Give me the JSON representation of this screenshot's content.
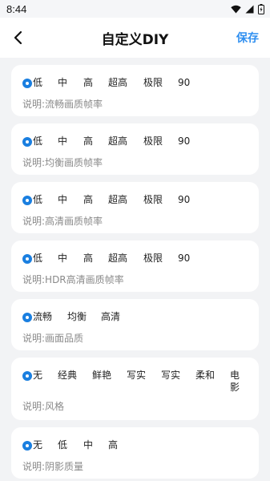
{
  "status": {
    "time": "8:44"
  },
  "nav": {
    "title": "自定义DIY",
    "save": "保存"
  },
  "cards": [
    {
      "options": [
        "低",
        "中",
        "高",
        "超高",
        "极限",
        "90"
      ],
      "desc": "说明:流畅画质帧率"
    },
    {
      "options": [
        "低",
        "中",
        "高",
        "超高",
        "极限",
        "90"
      ],
      "desc": "说明:均衡画质帧率"
    },
    {
      "options": [
        "低",
        "中",
        "高",
        "超高",
        "极限",
        "90"
      ],
      "desc": "说明:高清画质帧率"
    },
    {
      "options": [
        "低",
        "中",
        "高",
        "超高",
        "极限",
        "90"
      ],
      "desc": "说明:HDR高清画质帧率"
    },
    {
      "options": [
        "流畅",
        "均衡",
        "高清"
      ],
      "desc": "说明:画面品质"
    },
    {
      "options": [
        "无",
        "经典",
        "鲜艳",
        "写实",
        "写实",
        "柔和",
        "电影"
      ],
      "desc": "说明:风格"
    },
    {
      "options": [
        "无",
        "低",
        "中",
        "高"
      ],
      "desc": "说明:阴影质量"
    }
  ]
}
